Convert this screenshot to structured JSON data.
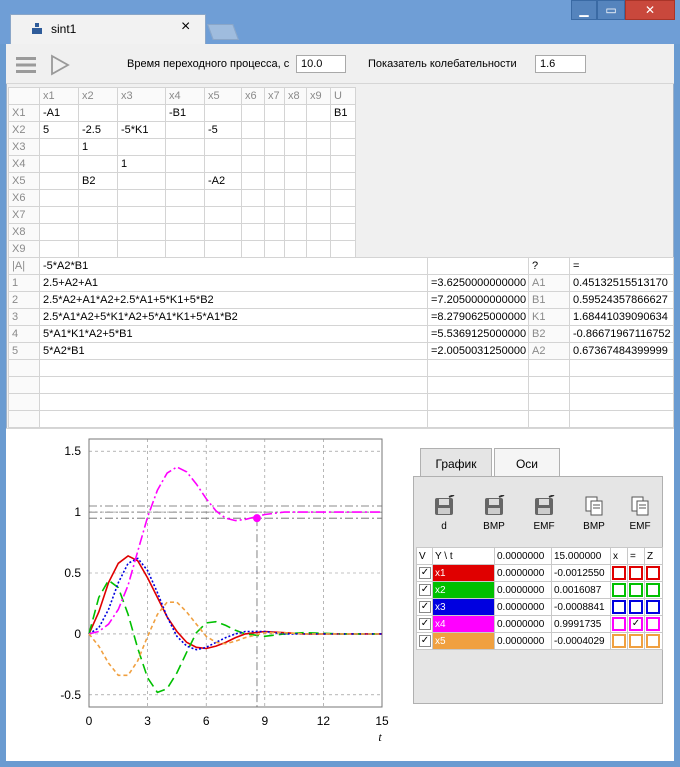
{
  "window": {
    "tab_title": "sint1",
    "close_glyph": "×",
    "min_glyph": "▁",
    "max_glyph": "▭",
    "close_win_glyph": "✕"
  },
  "toolbar": {
    "time_label": "Время переходного процесса, с",
    "time_value": "10.0",
    "osc_label": "Показатель колебательности",
    "osc_value": "1.6"
  },
  "matrix": {
    "col_headers": [
      "x1",
      "x2",
      "x3",
      "x4",
      "x5",
      "x6",
      "x7",
      "x8",
      "x9",
      "U"
    ],
    "rows": [
      {
        "label": "X1",
        "cells": [
          "-A1",
          "",
          "",
          "-B1",
          "",
          "",
          "",
          "",
          "",
          "B1"
        ]
      },
      {
        "label": "X2",
        "cells": [
          "5",
          "-2.5",
          "-5*K1",
          "",
          "-5",
          "",
          "",
          "",
          "",
          ""
        ]
      },
      {
        "label": "X3",
        "cells": [
          "",
          "1",
          "",
          "",
          "",
          "",
          "",
          "",
          "",
          ""
        ]
      },
      {
        "label": "X4",
        "cells": [
          "",
          "",
          "1",
          "",
          "",
          "",
          "",
          "",
          "",
          ""
        ]
      },
      {
        "label": "X5",
        "cells": [
          "",
          "B2",
          "",
          "",
          "-A2",
          "",
          "",
          "",
          "",
          ""
        ]
      },
      {
        "label": "X6",
        "cells": [
          "",
          "",
          "",
          "",
          "",
          "",
          "",
          "",
          "",
          ""
        ]
      },
      {
        "label": "X7",
        "cells": [
          "",
          "",
          "",
          "",
          "",
          "",
          "",
          "",
          "",
          ""
        ]
      },
      {
        "label": "X8",
        "cells": [
          "",
          "",
          "",
          "",
          "",
          "",
          "",
          "",
          "",
          ""
        ]
      },
      {
        "label": "X9",
        "cells": [
          "",
          "",
          "",
          "",
          "",
          "",
          "",
          "",
          "",
          ""
        ]
      }
    ]
  },
  "poly": {
    "header": {
      "label": "|A|",
      "expr": "-5*A2*B1",
      "q": "?",
      "eq": "="
    },
    "rows": [
      {
        "n": "1",
        "expr": "2.5+A2+A1",
        "val": "=3.6250000000000",
        "param": "A1",
        "pval": "0.45132515513170"
      },
      {
        "n": "2",
        "expr": "2.5*A2+A1*A2+2.5*A1+5*K1+5*B2",
        "val": "=7.2050000000000",
        "param": "B1",
        "pval": "0.59524357866627"
      },
      {
        "n": "3",
        "expr": "2.5*A1*A2+5*K1*A2+5*A1*K1+5*A1*B2",
        "val": "=8.2790625000000",
        "param": "K1",
        "pval": "1.68441039090634"
      },
      {
        "n": "4",
        "expr": "5*A1*K1*A2+5*B1",
        "val": "=5.5369125000000",
        "param": "B2",
        "pval": "-0.86671967116752"
      },
      {
        "n": "5",
        "expr": "5*A2*B1",
        "val": "=2.0050031250000",
        "param": "A2",
        "pval": "0.67367484399999"
      }
    ]
  },
  "panel": {
    "tabs": [
      "График",
      "Оси"
    ],
    "buttons": [
      "d",
      "BMP",
      "EMF",
      "BMP",
      "EMF"
    ],
    "table_headers": [
      "V",
      "Y \\ t",
      "0.0000000",
      "15.000000",
      "x",
      "=",
      "Z"
    ],
    "vars": [
      {
        "name": "x1",
        "color": "#e00000",
        "v0": "0.0000000",
        "v1": "-0.0012550",
        "checks": [
          false,
          false,
          false
        ]
      },
      {
        "name": "x2",
        "color": "#00c000",
        "v0": "0.0000000",
        "v1": "0.0016087",
        "checks": [
          false,
          false,
          false
        ]
      },
      {
        "name": "x3",
        "color": "#0000e0",
        "v0": "0.0000000",
        "v1": "-0.0008841",
        "checks": [
          false,
          false,
          false
        ]
      },
      {
        "name": "x4",
        "color": "#ff00ff",
        "v0": "0.0000000",
        "v1": "0.9991735",
        "checks": [
          false,
          true,
          false
        ]
      },
      {
        "name": "x5",
        "color": "#f0a040",
        "v0": "0.0000000",
        "v1": "-0.0004029",
        "checks": [
          false,
          false,
          false
        ]
      }
    ]
  },
  "chart_data": {
    "type": "line",
    "xlabel": "t",
    "xticks": [
      "0",
      "3",
      "6",
      "9",
      "12",
      "15"
    ],
    "yticks": [
      "1.5",
      "1",
      "0.5",
      "0",
      "-0.5"
    ],
    "xlim": [
      0,
      15
    ],
    "ylim": [
      -0.6,
      1.6
    ],
    "grid": true,
    "series": [
      {
        "name": "x1",
        "color": "#e00000",
        "dash": "",
        "points": [
          [
            0,
            0
          ],
          [
            0.5,
            0.18
          ],
          [
            1,
            0.42
          ],
          [
            1.5,
            0.58
          ],
          [
            2,
            0.64
          ],
          [
            2.5,
            0.6
          ],
          [
            3,
            0.46
          ],
          [
            3.5,
            0.3
          ],
          [
            4,
            0.14
          ],
          [
            4.5,
            0.02
          ],
          [
            5,
            -0.07
          ],
          [
            5.5,
            -0.11
          ],
          [
            6,
            -0.12
          ],
          [
            6.5,
            -0.1
          ],
          [
            7,
            -0.07
          ],
          [
            7.5,
            -0.03
          ],
          [
            8,
            0
          ],
          [
            9,
            0.02
          ],
          [
            10,
            0.01
          ],
          [
            11,
            0
          ],
          [
            13,
            0
          ],
          [
            15,
            0
          ]
        ]
      },
      {
        "name": "x2",
        "color": "#00c000",
        "dash": "10,5",
        "points": [
          [
            0,
            0
          ],
          [
            0.5,
            0.3
          ],
          [
            1,
            0.44
          ],
          [
            1.5,
            0.38
          ],
          [
            2,
            0.16
          ],
          [
            2.5,
            -0.12
          ],
          [
            3,
            -0.36
          ],
          [
            3.5,
            -0.48
          ],
          [
            4,
            -0.45
          ],
          [
            4.5,
            -0.32
          ],
          [
            5,
            -0.15
          ],
          [
            5.5,
            0.01
          ],
          [
            6,
            0.09
          ],
          [
            6.5,
            0.1
          ],
          [
            7,
            0.07
          ],
          [
            7.5,
            0.03
          ],
          [
            8,
            0
          ],
          [
            9,
            -0.02
          ],
          [
            10,
            0
          ],
          [
            11,
            0.01
          ],
          [
            13,
            0
          ],
          [
            15,
            0
          ]
        ]
      },
      {
        "name": "x3",
        "color": "#0000e0",
        "dash": "2,2",
        "points": [
          [
            0,
            0
          ],
          [
            0.5,
            0.05
          ],
          [
            1,
            0.2
          ],
          [
            1.5,
            0.42
          ],
          [
            2,
            0.58
          ],
          [
            2.5,
            0.62
          ],
          [
            3,
            0.52
          ],
          [
            3.5,
            0.34
          ],
          [
            4,
            0.14
          ],
          [
            4.5,
            -0.02
          ],
          [
            5,
            -0.1
          ],
          [
            5.5,
            -0.13
          ],
          [
            6,
            -0.11
          ],
          [
            6.5,
            -0.07
          ],
          [
            7,
            -0.03
          ],
          [
            7.5,
            0
          ],
          [
            8,
            0.02
          ],
          [
            9,
            0.02
          ],
          [
            10,
            0
          ],
          [
            11,
            0
          ],
          [
            13,
            0
          ],
          [
            15,
            0
          ]
        ]
      },
      {
        "name": "x4",
        "color": "#ff00ff",
        "dash": "10,3,2,3",
        "points": [
          [
            0,
            0
          ],
          [
            0.5,
            0.02
          ],
          [
            1,
            0.08
          ],
          [
            1.5,
            0.2
          ],
          [
            2,
            0.4
          ],
          [
            2.5,
            0.68
          ],
          [
            3,
            0.96
          ],
          [
            3.5,
            1.18
          ],
          [
            4,
            1.32
          ],
          [
            4.5,
            1.37
          ],
          [
            5,
            1.33
          ],
          [
            5.5,
            1.23
          ],
          [
            6,
            1.11
          ],
          [
            6.5,
            1.01
          ],
          [
            7,
            0.95
          ],
          [
            7.5,
            0.93
          ],
          [
            8,
            0.94
          ],
          [
            8.5,
            0.96
          ],
          [
            9,
            0.98
          ],
          [
            10,
            1.0
          ],
          [
            11,
            1.0
          ],
          [
            12,
            1.0
          ],
          [
            13,
            1.0
          ],
          [
            15,
            1.0
          ]
        ]
      },
      {
        "name": "x5",
        "color": "#f0a040",
        "dash": "4,3",
        "points": [
          [
            0,
            0
          ],
          [
            0.5,
            -0.1
          ],
          [
            1,
            -0.24
          ],
          [
            1.5,
            -0.34
          ],
          [
            2,
            -0.34
          ],
          [
            2.5,
            -0.22
          ],
          [
            3,
            -0.02
          ],
          [
            3.5,
            0.16
          ],
          [
            4,
            0.26
          ],
          [
            4.5,
            0.26
          ],
          [
            5,
            0.18
          ],
          [
            5.5,
            0.08
          ],
          [
            6,
            -0.02
          ],
          [
            6.5,
            -0.07
          ],
          [
            7,
            -0.08
          ],
          [
            7.5,
            -0.06
          ],
          [
            8,
            -0.03
          ],
          [
            9,
            0.01
          ],
          [
            10,
            0.01
          ],
          [
            11,
            0
          ],
          [
            13,
            0
          ],
          [
            15,
            0
          ]
        ]
      }
    ],
    "marker": {
      "x": 8.6,
      "y": 0.95,
      "color": "#ff00ff"
    },
    "ref_lines": [
      1.05,
      1.0,
      0.95
    ],
    "vline": 8.6
  }
}
